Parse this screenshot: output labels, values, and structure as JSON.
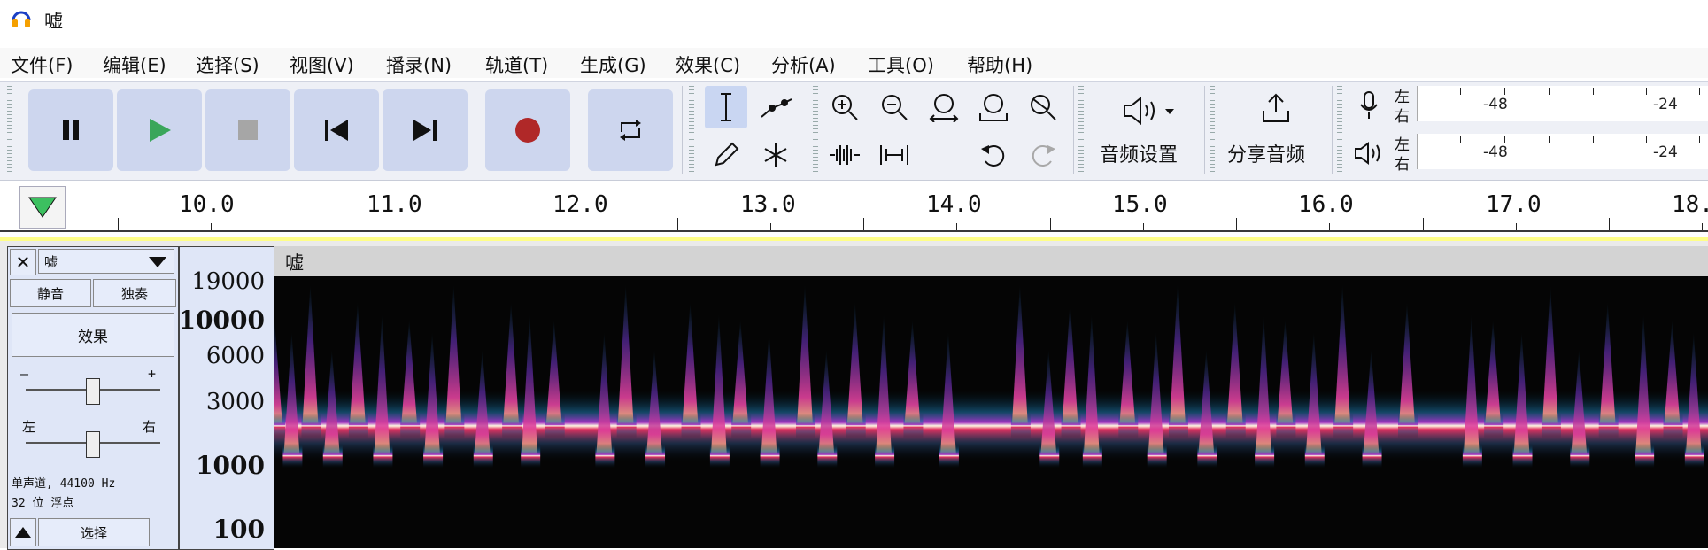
{
  "window": {
    "title": "嘘",
    "icon": "headphones-icon"
  },
  "menu": [
    "文件(F)",
    "编辑(E)",
    "选择(S)",
    "视图(V)",
    "播录(N)",
    "轨道(T)",
    "生成(G)",
    "效果(C)",
    "分析(A)",
    "工具(O)",
    "帮助(H)"
  ],
  "toolbar": {
    "transport": [
      "pause",
      "play",
      "stop",
      "skip-to-start",
      "skip-to-end",
      "record",
      "loop"
    ],
    "audio_setup_label": "音频设置",
    "share_audio_label": "分享音频",
    "meter_left": "左",
    "meter_right": "右",
    "meter_scale": [
      "-48",
      "-24"
    ]
  },
  "ruler": {
    "labels": [
      "10.0",
      "11.0",
      "12.0",
      "13.0",
      "14.0",
      "15.0",
      "16.0",
      "17.0",
      "18."
    ]
  },
  "track": {
    "name": "嘘",
    "mute_label": "静音",
    "solo_label": "独奏",
    "effects_label": "效果",
    "gain_minus": "–",
    "gain_plus": "+",
    "pan_left": "左",
    "pan_right": "右",
    "info_line1": "单声道, 44100 Hz",
    "info_line2": "32 位 浮点",
    "select_label": "选择",
    "clip_name": "嘘"
  },
  "freq_scale": [
    "19000",
    "10000",
    "6000",
    "3000",
    "1000",
    "100"
  ],
  "spectrogram": {
    "base_level": 0.55,
    "high_level": 0.66,
    "bursts": [
      [
        0.0,
        0.0
      ],
      [
        0.012,
        0.66
      ],
      [
        0.025,
        0.55
      ],
      [
        0.04,
        0.66
      ],
      [
        0.058,
        0.55
      ],
      [
        0.075,
        0.66
      ],
      [
        0.094,
        0.55
      ],
      [
        0.11,
        0.66
      ],
      [
        0.125,
        0.55
      ],
      [
        0.145,
        0.66
      ],
      [
        0.165,
        0.55
      ],
      [
        0.178,
        0.66
      ],
      [
        0.195,
        0.55
      ],
      [
        0.23,
        0.66
      ],
      [
        0.245,
        0.55
      ],
      [
        0.265,
        0.66
      ],
      [
        0.29,
        0.55
      ],
      [
        0.31,
        0.66
      ],
      [
        0.325,
        0.55
      ],
      [
        0.345,
        0.66
      ],
      [
        0.37,
        0.55
      ],
      [
        0.385,
        0.66
      ],
      [
        0.405,
        0.55
      ],
      [
        0.425,
        0.66
      ],
      [
        0.445,
        0.55
      ],
      [
        0.47,
        0.66
      ],
      [
        0.52,
        0.55
      ],
      [
        0.54,
        0.66
      ],
      [
        0.555,
        0.55
      ],
      [
        0.57,
        0.66
      ],
      [
        0.595,
        0.55
      ],
      [
        0.615,
        0.66
      ],
      [
        0.63,
        0.55
      ],
      [
        0.65,
        0.66
      ],
      [
        0.67,
        0.55
      ],
      [
        0.69,
        0.66
      ],
      [
        0.705,
        0.55
      ],
      [
        0.725,
        0.66
      ],
      [
        0.745,
        0.55
      ],
      [
        0.765,
        0.66
      ],
      [
        0.79,
        0.55
      ],
      [
        0.835,
        0.66
      ],
      [
        0.85,
        0.55
      ],
      [
        0.87,
        0.66
      ],
      [
        0.89,
        0.55
      ],
      [
        0.91,
        0.66
      ],
      [
        0.93,
        0.55
      ],
      [
        0.955,
        0.66
      ],
      [
        0.975,
        0.55
      ],
      [
        0.99,
        0.66
      ]
    ]
  }
}
